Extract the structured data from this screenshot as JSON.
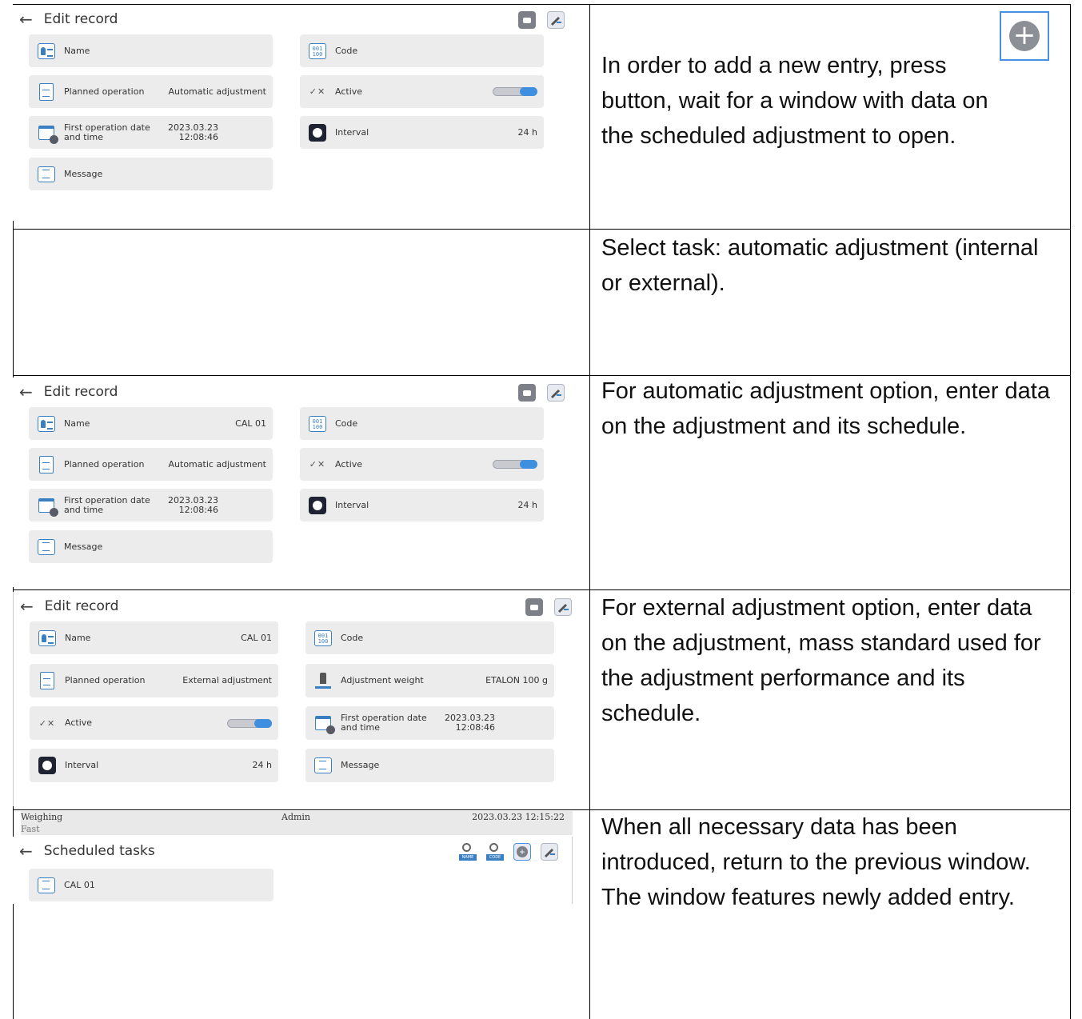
{
  "plus_symbol": "+",
  "rows": [
    {
      "screen": {
        "title": "Edit record",
        "tiles": [
          {
            "label": "Name",
            "value": "",
            "icon": "name-icon"
          },
          {
            "label": "Code",
            "value": "",
            "icon": "code-icon"
          },
          {
            "label": "Planned operation",
            "value": "Automatic adjustment",
            "icon": "document-icon"
          },
          {
            "label": "Active",
            "value": "",
            "icon": "checkbox-icon",
            "toggle": true
          },
          {
            "label": "First operation date and time",
            "value": "2023.03.23\n12:08:46",
            "icon": "calendar-clock-icon"
          },
          {
            "label": "Interval",
            "value": "24 h",
            "icon": "clock-icon"
          },
          {
            "label": "Message",
            "value": "",
            "icon": "message-icon"
          }
        ]
      },
      "description": "In order to add a new entry, press button, wait for a window with data on the scheduled adjustment to open."
    },
    {
      "description": "Select task: automatic adjustment (internal or external)."
    },
    {
      "screen": {
        "title": "Edit record",
        "tiles": [
          {
            "label": "Name",
            "value": "CAL 01"
          },
          {
            "label": "Code",
            "value": ""
          },
          {
            "label": "Planned operation",
            "value": "Automatic adjustment"
          },
          {
            "label": "Active",
            "value": ""
          },
          {
            "label": "First operation date and time",
            "value": "2023.03.23\n12:08:46"
          },
          {
            "label": "Interval",
            "value": "24 h"
          },
          {
            "label": "Message",
            "value": ""
          }
        ]
      },
      "description": "For automatic adjustment option, enter data on the adjustment and its schedule."
    },
    {
      "screen": {
        "title": "Edit record",
        "tiles": [
          {
            "label": "Name",
            "value": "CAL 01"
          },
          {
            "label": "Code",
            "value": ""
          },
          {
            "label": "Planned operation",
            "value": "External adjustment"
          },
          {
            "label": "Adjustment weight",
            "value": "ETALON 100 g"
          },
          {
            "label": "Active",
            "value": ""
          },
          {
            "label": "First operation date and time",
            "value": "2023.03.23\n12:08:46"
          },
          {
            "label": "Interval",
            "value": "24 h"
          },
          {
            "label": "Message",
            "value": ""
          }
        ]
      },
      "description": "For external adjustment option, enter data on the adjustment, mass standard used for the adjustment performance and its schedule."
    },
    {
      "screen": {
        "status_mode": "Weighing",
        "status_sub": "Fast",
        "status_user": "Admin",
        "status_datetime": "2023.03.23 12:15:22",
        "title": "Scheduled tasks",
        "search_name_label": "NAME",
        "search_code_label": "CODE",
        "items": [
          "CAL 01"
        ]
      },
      "description": "When all necessary data has been introduced, return to the previous window. The window features newly added entry."
    }
  ]
}
